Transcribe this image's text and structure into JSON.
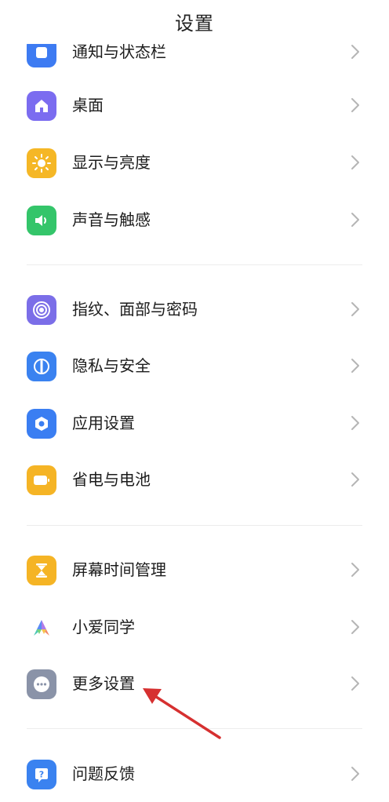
{
  "header": {
    "title": "设置"
  },
  "items": [
    {
      "label": "通知与状态栏",
      "icon": "notification-icon",
      "color": "#3d7bf2"
    },
    {
      "label": "桌面",
      "icon": "home-icon",
      "color": "#7b6cf0"
    },
    {
      "label": "显示与亮度",
      "icon": "sun-icon",
      "color": "#f5b726"
    },
    {
      "label": "声音与触感",
      "icon": "speaker-icon",
      "color": "#34c56a"
    },
    {
      "label": "指纹、面部与密码",
      "icon": "fingerprint-icon",
      "color": "#7b6ee8"
    },
    {
      "label": "隐私与安全",
      "icon": "shield-icon",
      "color": "#3a82f0"
    },
    {
      "label": "应用设置",
      "icon": "app-settings-icon",
      "color": "#3a7ef2"
    },
    {
      "label": "省电与电池",
      "icon": "battery-icon",
      "color": "#f5b425"
    },
    {
      "label": "屏幕时间管理",
      "icon": "hourglass-icon",
      "color": "#f5b425"
    },
    {
      "label": "小爱同学",
      "icon": "xiaoai-icon",
      "color": "#ffffff"
    },
    {
      "label": "更多设置",
      "icon": "more-icon",
      "color": "#8a93a8"
    },
    {
      "label": "问题反馈",
      "icon": "feedback-icon",
      "color": "#3a82f0"
    }
  ],
  "colors": {
    "arrow": "#d63030",
    "chevron": "#b5b5b5",
    "divider": "#ececec"
  }
}
